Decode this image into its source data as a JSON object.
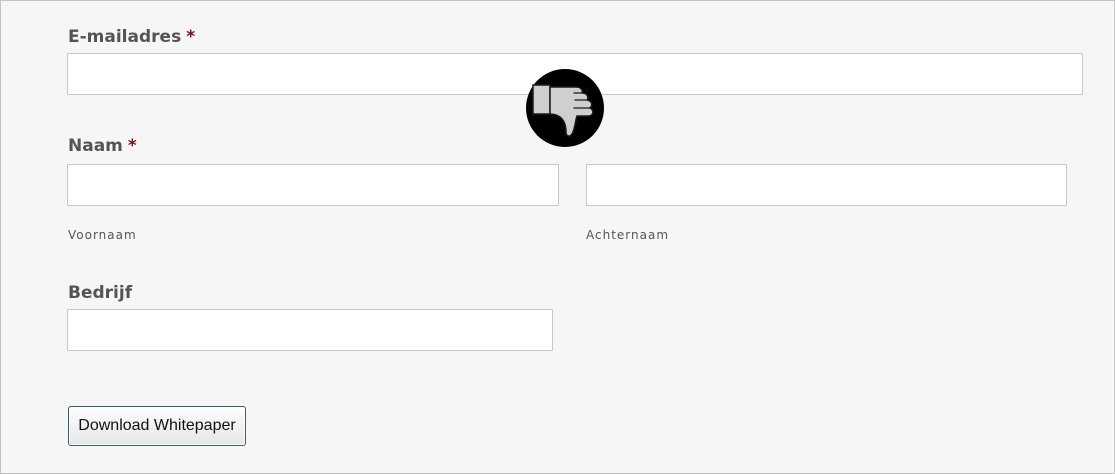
{
  "form": {
    "email": {
      "label": "E-mailadres",
      "required_marker": "*",
      "value": ""
    },
    "name": {
      "label": "Naam",
      "required_marker": "*",
      "first": {
        "value": "",
        "caption": "Voornaam"
      },
      "last": {
        "value": "",
        "caption": "Achternaam"
      }
    },
    "company": {
      "label": "Bedrijf",
      "value": ""
    },
    "submit_label": "Download Whitepaper"
  },
  "overlay": {
    "icon": "thumbs-down-icon",
    "colors": {
      "circle": "#000000",
      "hand": "#cfcfcf"
    }
  },
  "colors": {
    "page_background": "#f6f6f6",
    "label_text": "#545454",
    "required_marker": "#7a1010",
    "input_border": "#c8c8c8",
    "button_border": "#3c5a7a"
  }
}
